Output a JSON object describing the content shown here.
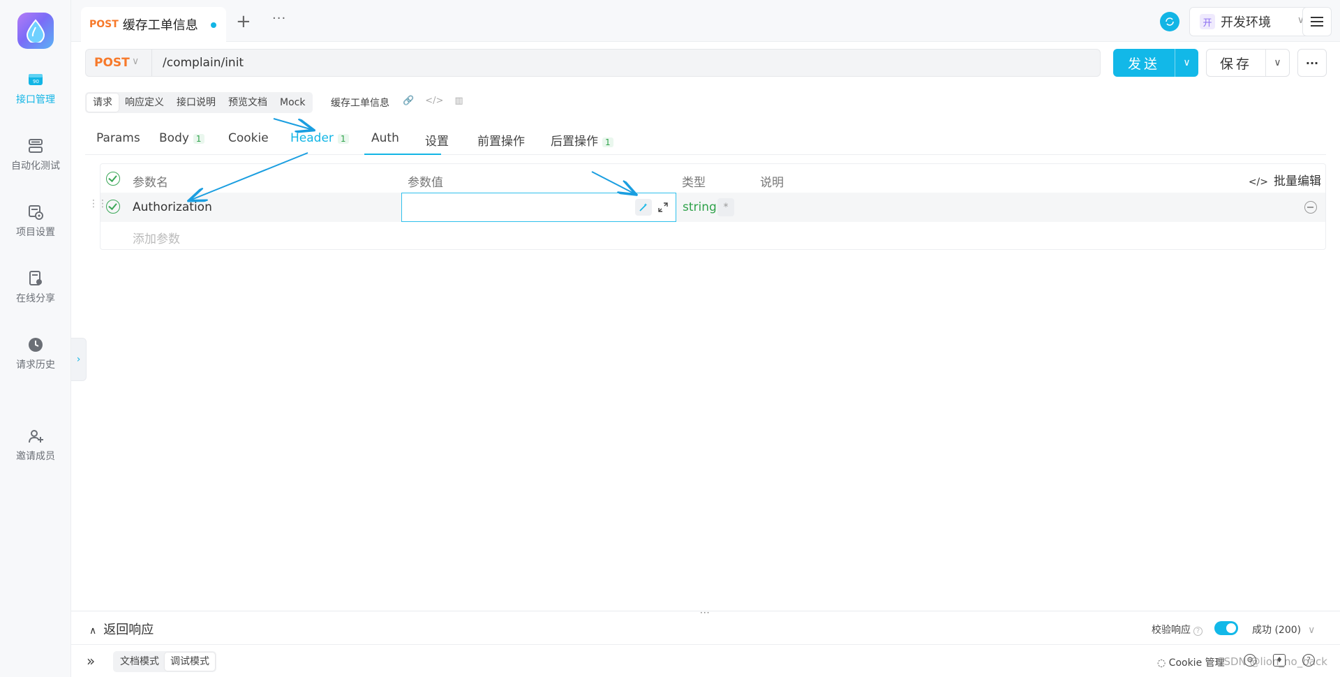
{
  "sidebar": {
    "items": [
      {
        "label": "接口管理",
        "icon": "api-icon",
        "active": true
      },
      {
        "label": "自动化测试",
        "icon": "automation-icon",
        "active": false
      },
      {
        "label": "项目设置",
        "icon": "project-settings-icon",
        "active": false
      },
      {
        "label": "在线分享",
        "icon": "share-icon",
        "active": false
      },
      {
        "label": "请求历史",
        "icon": "history-icon",
        "active": false
      },
      {
        "label": "邀请成员",
        "icon": "invite-member-icon",
        "active": false
      }
    ]
  },
  "tabs": {
    "active": {
      "method": "POST",
      "title": "缓存工单信息"
    },
    "more": "···"
  },
  "header": {
    "env_badge": "开",
    "env_name": "开发环境"
  },
  "request": {
    "method": "POST",
    "url": "/complain/init",
    "send_label": "发送",
    "save_label": "保存"
  },
  "subtabs": {
    "items": [
      "请求",
      "响应定义",
      "接口说明",
      "预览文档",
      "Mock"
    ],
    "active": "请求",
    "title": "缓存工单信息"
  },
  "param_tabs": {
    "params": "Params",
    "body": {
      "label": "Body",
      "count": "1"
    },
    "cookie": "Cookie",
    "header": {
      "label": "Header",
      "count": "1"
    },
    "auth": "Auth",
    "settings": "设置",
    "pre": "前置操作",
    "post": {
      "label": "后置操作",
      "count": "1"
    },
    "active": "Header"
  },
  "table": {
    "col_name": "参数名",
    "col_value": "参数值",
    "col_type": "类型",
    "col_desc": "说明",
    "batch_edit": "批量编辑",
    "rows": [
      {
        "name": "Authorization",
        "value": "",
        "type": "string",
        "required": "*"
      }
    ],
    "add_placeholder": "添加参数"
  },
  "response": {
    "title": "返回响应",
    "verify_label": "校验响应",
    "verify_on": true,
    "status": "成功 (200)"
  },
  "footer": {
    "modes": [
      "文档模式",
      "调试模式"
    ],
    "active_mode": "调试模式",
    "cookie": "Cookie 管理",
    "watermark": "CSDN @lion_no_back"
  },
  "colors": {
    "accent": "#12b5e5",
    "method": "#f7792a",
    "type": "#2fa24a"
  }
}
